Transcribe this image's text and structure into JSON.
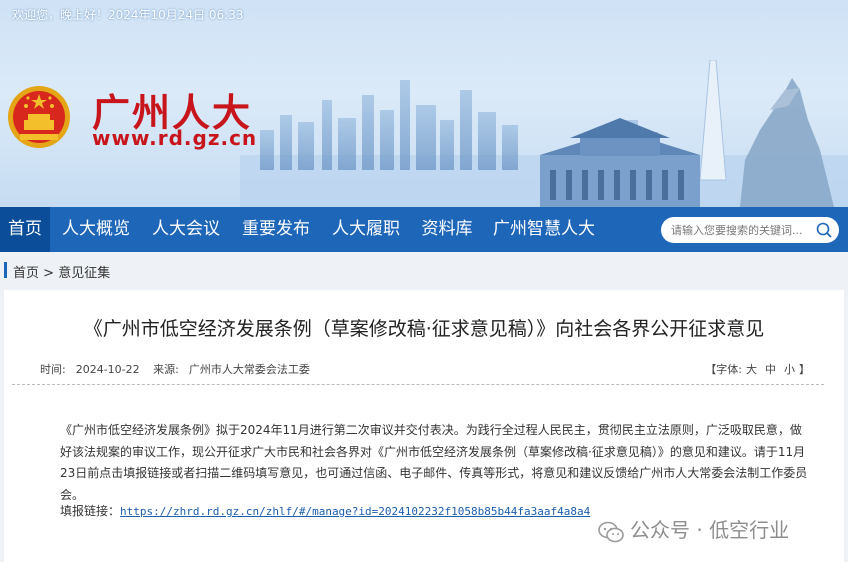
{
  "header": {
    "greeting": "欢迎您，晚上好！2024年10月24日 06:33",
    "site_title": "广州人大",
    "site_url": "www.rd.gz.cn"
  },
  "nav": {
    "items": [
      {
        "label": "首页",
        "active": true
      },
      {
        "label": "人大概览"
      },
      {
        "label": "人大会议"
      },
      {
        "label": "重要发布"
      },
      {
        "label": "人大履职"
      },
      {
        "label": "资料库"
      },
      {
        "label": "广州智慧人大"
      }
    ],
    "search_placeholder": "请输入您要搜索的关键词..."
  },
  "breadcrumb": {
    "home": "首页",
    "sep": " > ",
    "current": "意见征集"
  },
  "article": {
    "title": "《广州市低空经济发展条例（草案修改稿·征求意见稿）》向社会各界公开征求意见",
    "time_label": "时间:",
    "date": "2024-10-22",
    "source_label": "来源:",
    "source": "广州市人大常委会法工委",
    "fontsize_label": "【字体:",
    "font_large": "大",
    "font_medium": "中",
    "font_small": "小",
    "fontsize_end": "】",
    "body": "《广州市低空经济发展条例》拟于2024年11月进行第二次审议并交付表决。为践行全过程人民民主，贯彻民主立法原则，广泛吸取民意，做好该法规案的审议工作，现公开征求广大市民和社会各界对《广州市低空经济发展条例（草案修改稿·征求意见稿）》的意见和建议。请于11月23日前点击填报链接或者扫描二维码填写意见，也可通过信函、电子邮件、传真等形式，将意见和建议反馈给广州市人大常委会法制工作委员会。",
    "link_label": "填报链接：",
    "link_url": "https://zhrd.rd.gz.cn/zhlf/#/manage?id=2024102232f1058b85b44fa3aaf4a8a4"
  },
  "watermark": {
    "text": "公众号 · 低空行业"
  },
  "colors": {
    "brand_red": "#c8141b",
    "nav_blue": "#1e66b8",
    "nav_active": "#0b4d98"
  }
}
